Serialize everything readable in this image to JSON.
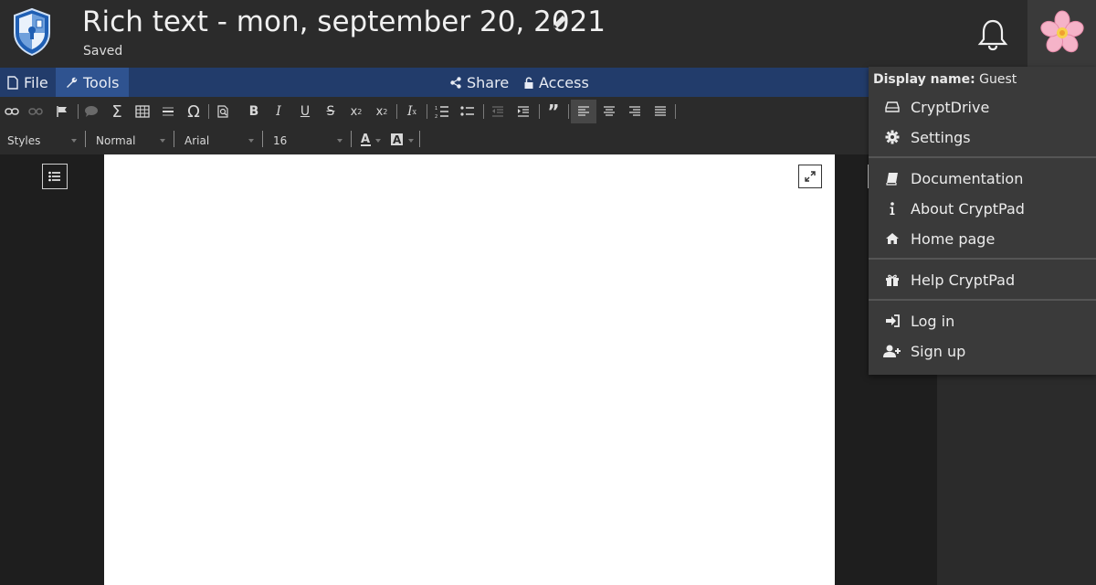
{
  "header": {
    "title": "Rich text - mon, september 20, 2021",
    "status": "Saved"
  },
  "menubar": {
    "file": "File",
    "tools": "Tools",
    "share": "Share",
    "access": "Access"
  },
  "toolbar": {
    "styles": "Styles",
    "format": "Normal",
    "font": "Arial",
    "size": "16"
  },
  "user_menu": {
    "display_label": "Display name:",
    "display_value": "Guest",
    "items": [
      {
        "label": "CryptDrive",
        "icon": "drive-icon"
      },
      {
        "label": "Settings",
        "icon": "gear-icon"
      },
      {
        "label": "Documentation",
        "icon": "book-icon"
      },
      {
        "label": "About CryptPad",
        "icon": "info-icon"
      },
      {
        "label": "Home page",
        "icon": "home-icon"
      },
      {
        "label": "Help CryptPad",
        "icon": "gift-icon"
      },
      {
        "label": "Log in",
        "icon": "login-icon"
      },
      {
        "label": "Sign up",
        "icon": "user-plus-icon"
      }
    ]
  },
  "colors": {
    "menubar": "#223c6b",
    "menubar_active": "#2f5390",
    "topbar": "#2b2b2b",
    "dropdown": "#3a3a3a"
  }
}
